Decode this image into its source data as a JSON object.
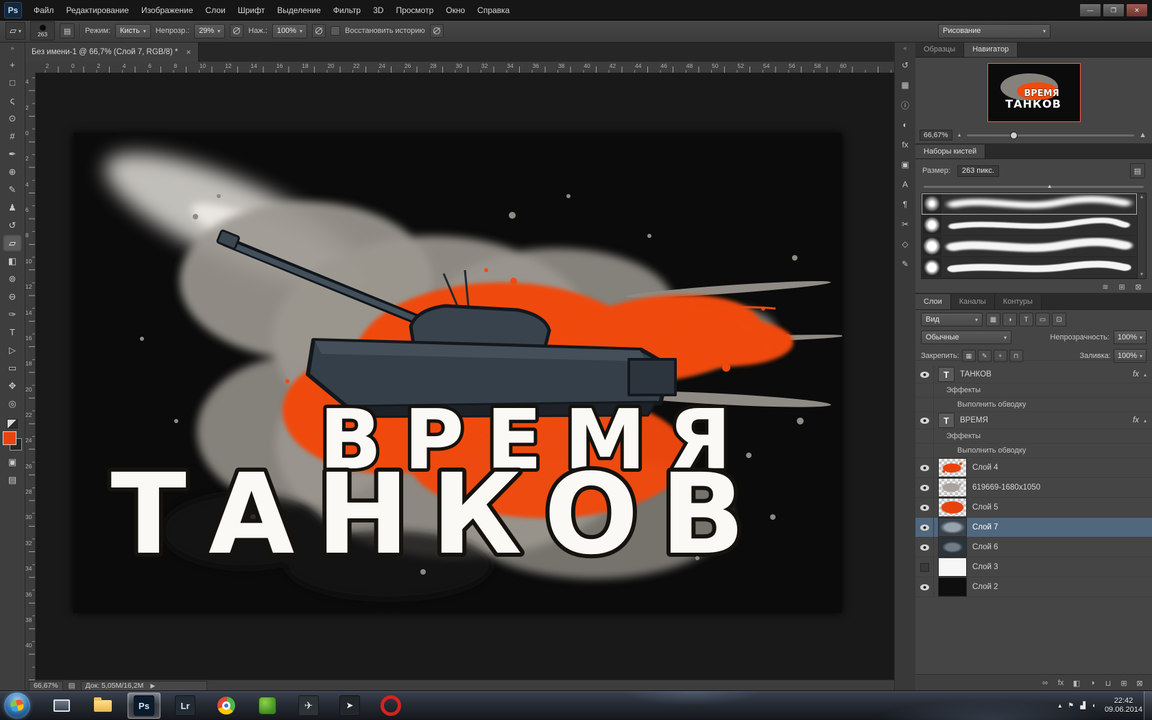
{
  "app": {
    "badge": "Ps"
  },
  "menubar": {
    "items": [
      "Файл",
      "Редактирование",
      "Изображение",
      "Слои",
      "Шрифт",
      "Выделение",
      "Фильтр",
      "3D",
      "Просмотр",
      "Окно",
      "Справка"
    ]
  },
  "window_controls": {
    "minimize": "—",
    "restore": "❐",
    "close": "✕"
  },
  "chevrons": {
    "tools": "»",
    "dock": "«"
  },
  "options_bar": {
    "tool_glyph": "▱",
    "brush_size": "263",
    "mode_label": "Режим:",
    "mode_value": "Кисть",
    "opacity_label": "Непрозр.:",
    "opacity_value": "29%",
    "flow_label": "Наж.:",
    "flow_value": "100%",
    "history_label": "Восстановить историю",
    "workspace_value": "Рисование"
  },
  "doc_tab": {
    "title": "Без имени-1 @ 66,7% (Слой 7, RGB/8) *",
    "close": "×"
  },
  "rulers": {
    "h_labels": [
      "4",
      "2",
      "0",
      "2",
      "4",
      "6",
      "8",
      "10",
      "12",
      "14",
      "16",
      "18",
      "20",
      "22",
      "24",
      "26",
      "28",
      "30",
      "32",
      "34",
      "36",
      "38",
      "40",
      "42",
      "44",
      "46",
      "48",
      "50",
      "52",
      "54",
      "56",
      "58",
      "60"
    ],
    "v_labels": [
      "4",
      "2",
      "0",
      "2",
      "4",
      "6",
      "8",
      "10",
      "12",
      "14",
      "16",
      "18",
      "20",
      "22",
      "24",
      "26",
      "28",
      "30",
      "32",
      "34",
      "36",
      "38",
      "40"
    ]
  },
  "tools": [
    {
      "name": "move-tool",
      "glyph": "+"
    },
    {
      "name": "rectangular-marquee-tool",
      "glyph": "□"
    },
    {
      "name": "lasso-tool",
      "glyph": "ς"
    },
    {
      "name": "quick-selection-tool",
      "glyph": "⊙"
    },
    {
      "name": "crop-tool",
      "glyph": "#"
    },
    {
      "name": "eyedropper-tool",
      "glyph": "✒"
    },
    {
      "name": "healing-brush-tool",
      "glyph": "⊕"
    },
    {
      "name": "brush-tool",
      "glyph": "✎"
    },
    {
      "name": "clone-stamp-tool",
      "glyph": "♟"
    },
    {
      "name": "history-brush-tool",
      "glyph": "↺"
    },
    {
      "name": "eraser-tool",
      "glyph": "▱",
      "selected": true
    },
    {
      "name": "gradient-tool",
      "glyph": "◧"
    },
    {
      "name": "blur-tool",
      "glyph": "⊚"
    },
    {
      "name": "dodge-tool",
      "glyph": "⊖"
    },
    {
      "name": "pen-tool",
      "glyph": "✑"
    },
    {
      "name": "type-tool",
      "glyph": "T"
    },
    {
      "name": "path-selection-tool",
      "glyph": "▷"
    },
    {
      "name": "rectangle-tool",
      "glyph": "▭"
    },
    {
      "name": "hand-tool",
      "glyph": "✥"
    },
    {
      "name": "zoom-tool",
      "glyph": "◎"
    }
  ],
  "toolbar_colors": {
    "foreground": "#e8430f",
    "background": "#262626"
  },
  "panel_strip": [
    {
      "name": "history-panel-icon",
      "glyph": "↺"
    },
    {
      "name": "swatches-panel-icon",
      "glyph": "▦"
    },
    {
      "name": "info-panel-icon",
      "glyph": "ⓘ"
    },
    {
      "name": "adjustments-panel-icon",
      "glyph": "◐"
    },
    {
      "name": "styles-panel-icon",
      "glyph": "fx"
    },
    {
      "name": "layer-comps-panel-icon",
      "glyph": "▣"
    },
    {
      "name": "character-panel-icon",
      "glyph": "A"
    },
    {
      "name": "paragraph-panel-icon",
      "glyph": "¶"
    },
    {
      "name": "clone-source-panel-icon",
      "glyph": "✂"
    },
    {
      "name": "3d-panel-icon",
      "glyph": "◇"
    },
    {
      "name": "tool-presets-panel-icon",
      "glyph": "✎"
    }
  ],
  "navigator": {
    "tab_inactive": "Образцы",
    "tab_active": "Навигатор",
    "zoom": "66,67%",
    "mountain_small": "▲",
    "mountain_big": "▲"
  },
  "brush_panel": {
    "header": "Наборы кистей",
    "size_label": "Размер:",
    "size_value": "263 пикс.",
    "brushes": [
      {
        "name": "airbrush-soft"
      },
      {
        "name": "round-medium"
      },
      {
        "name": "round-large"
      },
      {
        "name": "round-flat"
      }
    ],
    "bottom_icons": [
      {
        "name": "brush-stroke-preview-icon",
        "glyph": "≋"
      },
      {
        "name": "new-brush-icon",
        "glyph": "⊞"
      },
      {
        "name": "delete-brush-icon",
        "glyph": "⊠"
      }
    ]
  },
  "layers_panel": {
    "tabs": [
      "Слои",
      "Каналы",
      "Контуры"
    ],
    "filter_value": "Вид",
    "blend_value": "Обычные",
    "opacity_label": "Непрозрачность:",
    "opacity_value": "100%",
    "lock_label": "Закрепить:",
    "fill_label": "Заливка:",
    "fill_value": "100%",
    "fx_badge": "fx",
    "filter_icons": [
      {
        "name": "filter-pixel-layers-icon",
        "glyph": "▦"
      },
      {
        "name": "filter-adjustment-layers-icon",
        "glyph": "◑"
      },
      {
        "name": "filter-type-layers-icon",
        "glyph": "T"
      },
      {
        "name": "filter-shape-layers-icon",
        "glyph": "▭"
      },
      {
        "name": "filter-smart-objects-icon",
        "glyph": "⊡"
      }
    ],
    "lock_icons": [
      {
        "name": "lock-transparency-icon",
        "glyph": "▦"
      },
      {
        "name": "lock-pixels-icon",
        "glyph": "✎"
      },
      {
        "name": "lock-position-icon",
        "glyph": "+"
      },
      {
        "name": "lock-all-icon",
        "glyph": "⊓"
      }
    ],
    "rows": [
      {
        "kind": "text",
        "name": "ТАНКОВ",
        "fx": true,
        "visible": true
      },
      {
        "kind": "sub1",
        "name": "Эффекты",
        "visible": true
      },
      {
        "kind": "sub2",
        "name": "Выполнить обводку",
        "visible": true
      },
      {
        "kind": "text",
        "name": "ВРЕМЯ",
        "fx": true,
        "visible": true
      },
      {
        "kind": "sub1",
        "name": "Эффекты",
        "visible": true
      },
      {
        "kind": "sub2",
        "name": "Выполнить обводку",
        "visible": true
      },
      {
        "kind": "image",
        "name": "Слой 4",
        "thumb": "red-splash",
        "visible": true
      },
      {
        "kind": "image",
        "name": "619669-1680x1050",
        "thumb": "grey-splash",
        "visible": true
      },
      {
        "kind": "image",
        "name": "Слой 5",
        "thumb": "red-blob",
        "visible": true
      },
      {
        "kind": "image",
        "name": "Слой 7",
        "thumb": "dark-splash",
        "visible": true,
        "selected": true
      },
      {
        "kind": "image",
        "name": "Слой 6",
        "thumb": "dark-splash-2",
        "visible": true
      },
      {
        "kind": "image",
        "name": "Слой 3",
        "thumb": "white",
        "visible": false
      },
      {
        "kind": "image",
        "name": "Слой 2",
        "thumb": "black",
        "visible": true
      }
    ],
    "bottom_icons": [
      {
        "name": "link-layers-icon",
        "glyph": "∞"
      },
      {
        "name": "layer-style-icon",
        "glyph": "fx"
      },
      {
        "name": "layer-mask-icon",
        "glyph": "◧"
      },
      {
        "name": "adjustment-layer-icon",
        "glyph": "◑"
      },
      {
        "name": "layer-group-icon",
        "glyph": "⊔"
      },
      {
        "name": "new-layer-icon",
        "glyph": "⊞"
      },
      {
        "name": "delete-layer-icon",
        "glyph": "⊠"
      }
    ]
  },
  "status_bar": {
    "zoom": "66,67%",
    "doc_info": "Док: 5,05M/16,2M",
    "arrow": "▶"
  },
  "artwork": {
    "line1": "ВРЕМЯ",
    "line2": "ТАНКОВ"
  },
  "taskbar": {
    "time": "22:42",
    "date": "09.06.2014",
    "tray_icons": [
      {
        "name": "hidden-icons-button",
        "glyph": "▴"
      },
      {
        "name": "action-center-icon",
        "glyph": "⚑"
      },
      {
        "name": "network-icon",
        "glyph": "▟"
      },
      {
        "name": "volume-icon",
        "glyph": "◖"
      }
    ],
    "apps": [
      {
        "name": "taskbar-window-button",
        "kind": "winmini"
      },
      {
        "name": "taskbar-explorer-button",
        "kind": "folder"
      },
      {
        "name": "taskbar-photoshop-button",
        "kind": "ps",
        "label": "Ps",
        "active": true
      },
      {
        "name": "taskbar-lightroom-button",
        "kind": "lr",
        "label": "Lr"
      },
      {
        "name": "taskbar-chrome-button",
        "kind": "chrome"
      },
      {
        "name": "taskbar-green-app-button",
        "kind": "green"
      },
      {
        "name": "taskbar-aircraft-app-button",
        "kind": "plane",
        "label": "✈"
      },
      {
        "name": "taskbar-media-app-button",
        "kind": "play",
        "label": "➤"
      },
      {
        "name": "taskbar-opera-button",
        "kind": "opera"
      }
    ]
  }
}
